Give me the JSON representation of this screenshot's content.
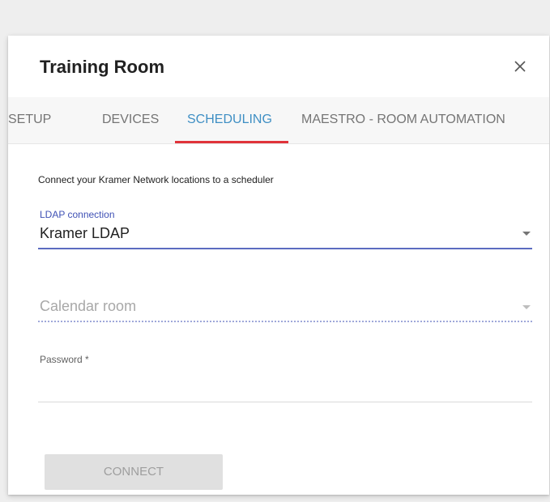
{
  "dialog": {
    "title": "Training Room",
    "close_icon": "close-icon"
  },
  "tabs": [
    {
      "label": "SETUP",
      "active": false
    },
    {
      "label": "DEVICES",
      "active": false
    },
    {
      "label": "SCHEDULING",
      "active": true
    },
    {
      "label": "MAESTRO - ROOM AUTOMATION",
      "active": false
    }
  ],
  "colors": {
    "active_tab": "#3f8fc4",
    "tab_indicator": "#e0333a",
    "field_accent": "#5c6bc0",
    "disabled_button_bg": "#e0e0e0"
  },
  "scheduling": {
    "description": "Connect your Kramer Network locations to a scheduler",
    "ldap": {
      "label": "LDAP connection",
      "value": "Kramer LDAP"
    },
    "calendar_room": {
      "placeholder": "Calendar room",
      "disabled": true
    },
    "password": {
      "label": "Password *",
      "value": ""
    },
    "connect_button": {
      "label": "CONNECT",
      "disabled": true
    }
  }
}
